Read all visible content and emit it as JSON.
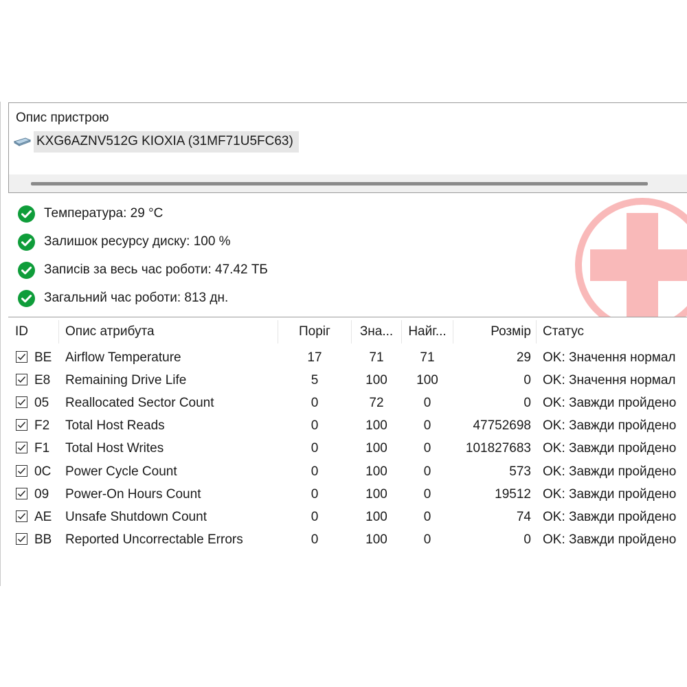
{
  "device_panel": {
    "title": "Опис пристрою",
    "device_name": "KXG6AZNV512G KIOXIA (31MF71U5FC63)",
    "device_icon": "drive-icon"
  },
  "status_items": [
    {
      "icon": "check-circle-icon",
      "text": "Температура: 29 °C"
    },
    {
      "icon": "check-circle-icon",
      "text": "Залишок ресурсу диску: 100 %"
    },
    {
      "icon": "check-circle-icon",
      "text": "Записів за весь час роботи: 47.42 ТБ"
    },
    {
      "icon": "check-circle-icon",
      "text": "Загальний час роботи: 813 дн."
    }
  ],
  "health_badge": {
    "icon": "health-cross-icon",
    "color": "#f9b9b9"
  },
  "colors": {
    "ok_green": "#0f9d3a",
    "selection_gray": "#e6e6e6"
  },
  "table": {
    "columns": [
      "ID",
      "Опис атрибута",
      "Поріг",
      "Зна...",
      "Найг...",
      "Розмір",
      "Статус"
    ],
    "rows": [
      {
        "checked": true,
        "id": "BE",
        "name": "Airflow Temperature",
        "threshold": "17",
        "value": "71",
        "worst": "71",
        "raw": "29",
        "status": "OK: Значення нормал"
      },
      {
        "checked": true,
        "id": "E8",
        "name": "Remaining Drive Life",
        "threshold": "5",
        "value": "100",
        "worst": "100",
        "raw": "0",
        "status": "OK: Значення нормал"
      },
      {
        "checked": true,
        "id": "05",
        "name": "Reallocated Sector Count",
        "threshold": "0",
        "value": "72",
        "worst": "0",
        "raw": "0",
        "status": "OK: Завжди пройдено"
      },
      {
        "checked": true,
        "id": "F2",
        "name": "Total Host Reads",
        "threshold": "0",
        "value": "100",
        "worst": "0",
        "raw": "47752698",
        "status": "OK: Завжди пройдено"
      },
      {
        "checked": true,
        "id": "F1",
        "name": "Total Host Writes",
        "threshold": "0",
        "value": "100",
        "worst": "0",
        "raw": "101827683",
        "status": "OK: Завжди пройдено"
      },
      {
        "checked": true,
        "id": "0C",
        "name": "Power Cycle Count",
        "threshold": "0",
        "value": "100",
        "worst": "0",
        "raw": "573",
        "status": "OK: Завжди пройдено"
      },
      {
        "checked": true,
        "id": "09",
        "name": "Power-On Hours Count",
        "threshold": "0",
        "value": "100",
        "worst": "0",
        "raw": "19512",
        "status": "OK: Завжди пройдено"
      },
      {
        "checked": true,
        "id": "AE",
        "name": "Unsafe Shutdown Count",
        "threshold": "0",
        "value": "100",
        "worst": "0",
        "raw": "74",
        "status": "OK: Завжди пройдено"
      },
      {
        "checked": true,
        "id": "BB",
        "name": "Reported Uncorrectable Errors",
        "threshold": "0",
        "value": "100",
        "worst": "0",
        "raw": "0",
        "status": "OK: Завжди пройдено"
      }
    ]
  }
}
